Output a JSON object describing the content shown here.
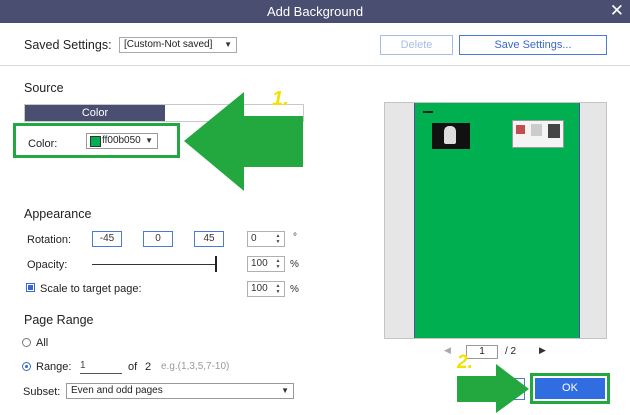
{
  "window": {
    "title": "Add Background",
    "close_glyph": "✕"
  },
  "saved_settings": {
    "label": "Saved Settings:",
    "value": "[Custom-Not saved]",
    "delete_label": "Delete",
    "save_label": "Save Settings..."
  },
  "source": {
    "heading": "Source",
    "tabs": [
      {
        "label": "Color",
        "selected": true
      },
      {
        "label": "",
        "selected": false
      }
    ],
    "color_label": "Color:",
    "color_value": "ff00b050",
    "swatch_color": "#00b050"
  },
  "appearance": {
    "heading": "Appearance",
    "rotation_label": "Rotation:",
    "rotation_presets": [
      "-45",
      "0",
      "45"
    ],
    "rotation_value": "0",
    "rotation_unit": "°",
    "opacity_label": "Opacity:",
    "opacity_percent": 100,
    "opacity_value": "100",
    "opacity_unit": "%",
    "scale_label": "Scale to target page:",
    "scale_checked": true,
    "scale_value": "100",
    "scale_unit": "%"
  },
  "page_range": {
    "heading": "Page Range",
    "all_label": "All",
    "range_label": "Range:",
    "range_value": "1",
    "of_label": "of",
    "total_pages": "2",
    "hint": "e.g.(1,3,5,7-10)",
    "subset_label": "Subset:",
    "subset_value": "Even and odd pages",
    "selected_option": "range"
  },
  "preview": {
    "page_input": "1",
    "page_total": "/ 2",
    "prev_glyph": "◀",
    "next_glyph": "▶",
    "background_color": "#00b050"
  },
  "annotations": {
    "step1": "1.",
    "step2": "2.",
    "arrow_color": "#22a83f",
    "number_color": "#f2e200"
  },
  "buttons": {
    "ok_label": "OK"
  }
}
